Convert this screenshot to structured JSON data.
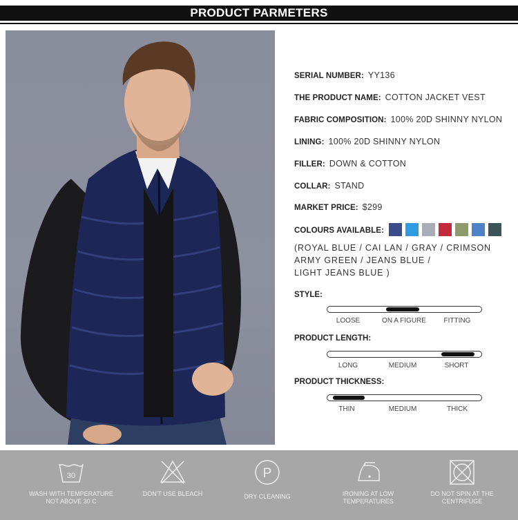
{
  "header": {
    "title": "PRODUCT PARMETERS"
  },
  "specs": {
    "serial_label": "SERIAL NUMBER:",
    "serial_value": "YY136",
    "name_label": "THE PRODUCT NAME:",
    "name_value": "COTTON JACKET VEST",
    "fabric_label": "FABRIC COMPOSITION:",
    "fabric_value": "100%  20D SHINNY NYLON",
    "lining_label": "LINING:",
    "lining_value": "100%  20D SHINNY NYLON",
    "filler_label": "FILLER:",
    "filler_value": "DOWN & COTTON",
    "collar_label": "COLLAR:",
    "collar_value": "STAND",
    "price_label": "MARKET PRICE:",
    "price_value": "$299",
    "colours_label": "COLOURS AVAILABLE:"
  },
  "swatch_colors": [
    "#3a4c8a",
    "#2f9be0",
    "#a9adb8",
    "#c52a3c",
    "#8e9a6a",
    "#4f82c6",
    "#3d5558"
  ],
  "colour_names": {
    "line1": "(ROYAL BLUE / CAI LAN  / GRAY / CRIMSON",
    "line2": "ARMY GREEN / JEANS BLUE /",
    "line3": "LIGHT JEANS BLUE )"
  },
  "scales": {
    "style": {
      "label": "STYLE:",
      "ticks": [
        "LOOSE",
        "ON A FIGURE",
        "FITTING"
      ],
      "selected": "ON A FIGURE"
    },
    "length": {
      "label": "PRODUCT LENGTH:",
      "ticks": [
        "LONG",
        "MEDIUM",
        "SHORT"
      ],
      "selected": "SHORT"
    },
    "thickness": {
      "label": "PRODUCT THICKNESS:",
      "ticks": [
        "THIN",
        "MEDIUM",
        "THICK"
      ],
      "selected": "THIN"
    }
  },
  "care": [
    {
      "icon": "wash-30-icon",
      "line1": "WASH WITH TEMPERATURE",
      "line2": "NOT ABOVE 30 C",
      "badge": "30"
    },
    {
      "icon": "no-bleach-icon",
      "line1": "DON'T USE BLEACH",
      "line2": ""
    },
    {
      "icon": "dry-clean-icon",
      "line1": "DRY CLEANING",
      "line2": "",
      "badge": "P"
    },
    {
      "icon": "iron-low-icon",
      "line1": "IRONING AT LOW",
      "line2": "TEMPERATURES"
    },
    {
      "icon": "no-spin-icon",
      "line1": "DO NOT SPIN AT THE",
      "line2": "CENTRIFUGE"
    }
  ]
}
